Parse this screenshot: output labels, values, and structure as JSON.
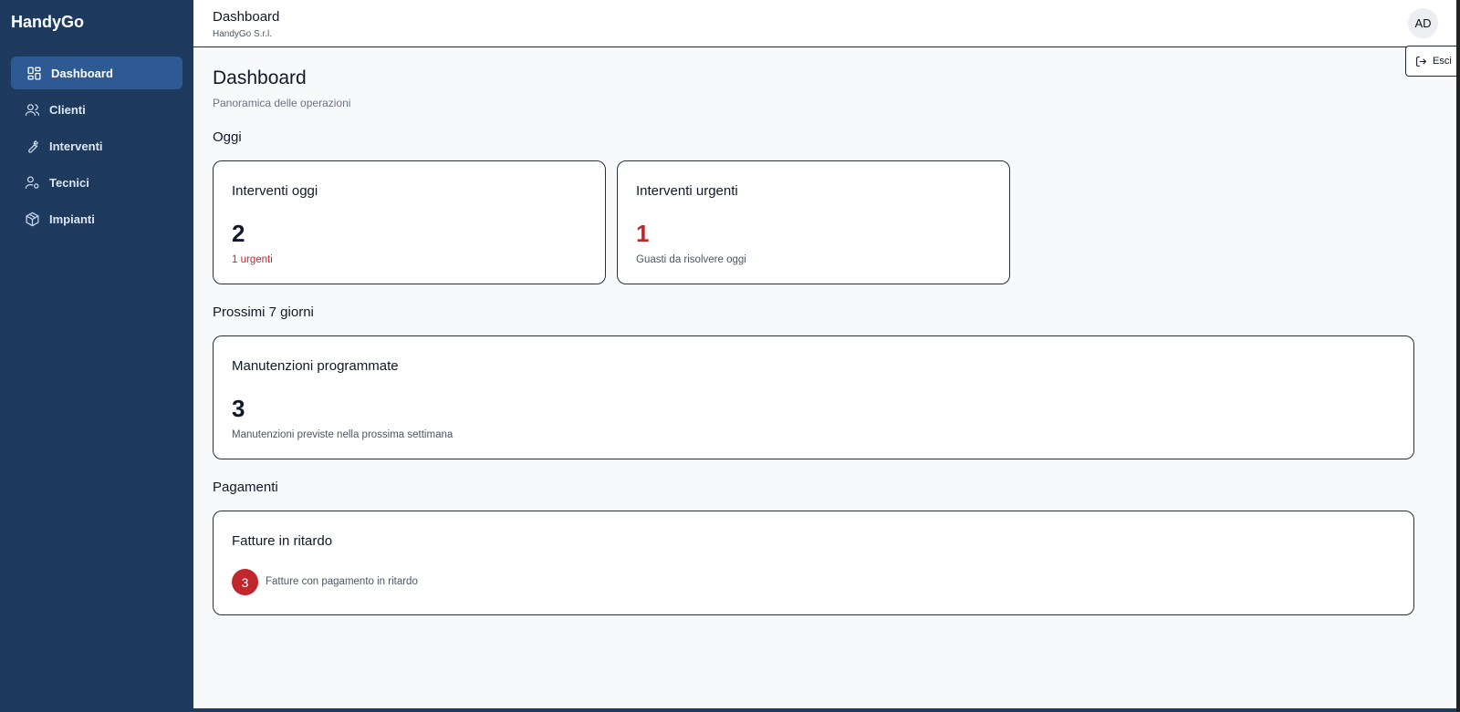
{
  "sidebar": {
    "brand": "HandyGo",
    "items": [
      {
        "label": "Dashboard",
        "icon": "dashboard-grid-icon",
        "active": true
      },
      {
        "label": "Clienti",
        "icon": "users-icon"
      },
      {
        "label": "Interventi",
        "icon": "wrench-icon"
      },
      {
        "label": "Tecnici",
        "icon": "user-settings-icon"
      },
      {
        "label": "Impianti",
        "icon": "box-icon"
      }
    ]
  },
  "header": {
    "title": "Dashboard",
    "subtitle": "HandyGo S.r.l.",
    "avatar": "AD",
    "logout_label": "Esci"
  },
  "page": {
    "title": "Dashboard",
    "subtitle": "Panoramica delle operazioni"
  },
  "sections": {
    "today": "Oggi",
    "next7": "Prossimi 7 giorni",
    "payments": "Pagamenti"
  },
  "cards": {
    "interventi_oggi": {
      "title": "Interventi oggi",
      "value": "2",
      "note": "1 urgenti"
    },
    "interventi_urgenti": {
      "title": "Interventi urgenti",
      "value": "1",
      "note": "Guasti da risolvere oggi"
    },
    "manutenzioni": {
      "title": "Manutenzioni programmate",
      "value": "3",
      "note": "Manutenzioni previste nella prossima settimana"
    },
    "fatture": {
      "title": "Fatture in ritardo",
      "value": "3",
      "note": "Fatture con pagamento in ritardo"
    }
  },
  "colors": {
    "sidebar_bg": "#1e3a5f",
    "active_item": "#2e5a93",
    "danger": "#c0272d"
  }
}
